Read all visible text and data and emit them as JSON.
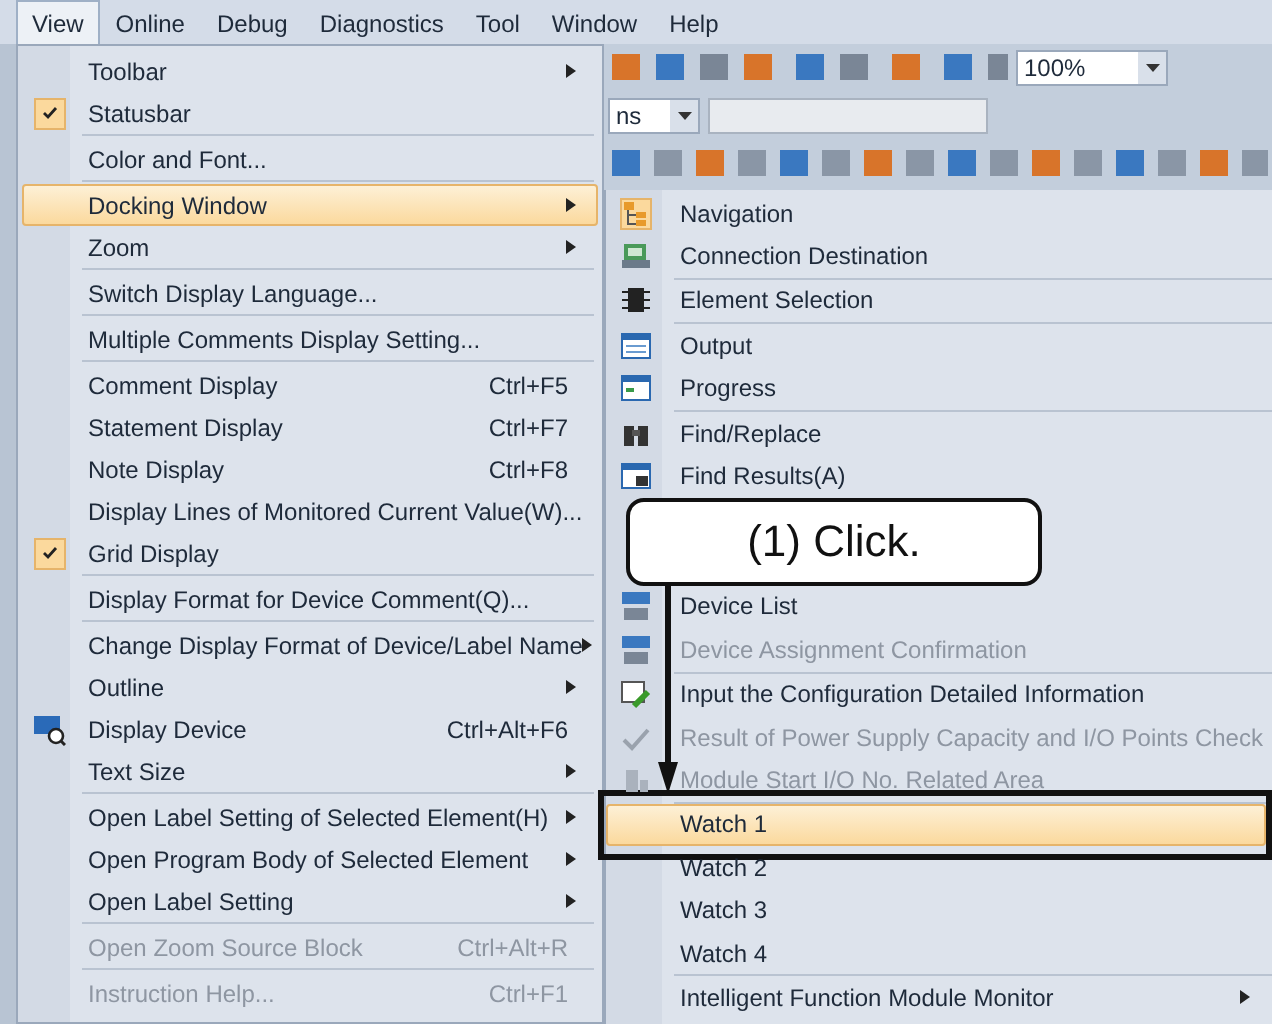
{
  "menubar": [
    {
      "label": "View",
      "selected": true
    },
    {
      "label": "Online",
      "selected": false
    },
    {
      "label": "Debug",
      "selected": false
    },
    {
      "label": "Diagnostics",
      "selected": false
    },
    {
      "label": "Tool",
      "selected": false
    },
    {
      "label": "Window",
      "selected": false
    },
    {
      "label": "Help",
      "selected": false
    }
  ],
  "toolbar": {
    "zoom_value": "100%",
    "combo_text": "ns"
  },
  "view_menu": [
    [
      {
        "label": "Toolbar",
        "checked": false,
        "selected": false,
        "disabled": false,
        "submenu": true
      },
      {
        "label": "Statusbar",
        "checked": true,
        "selected": false,
        "disabled": false,
        "submenu": false
      }
    ],
    [
      {
        "label": "Color and Font...",
        "checked": false,
        "selected": false,
        "disabled": false,
        "submenu": false
      }
    ],
    [
      {
        "label": "Docking Window",
        "checked": false,
        "selected": true,
        "disabled": false,
        "submenu": true
      },
      {
        "label": "Zoom",
        "checked": false,
        "selected": false,
        "disabled": false,
        "submenu": true
      }
    ],
    [
      {
        "label": "Switch Display Language...",
        "checked": false,
        "selected": false,
        "disabled": false,
        "submenu": false
      }
    ],
    [
      {
        "label": "Multiple Comments Display Setting...",
        "checked": false,
        "selected": false,
        "disabled": false,
        "submenu": false
      }
    ],
    [
      {
        "label": "Comment Display",
        "shortcut": "Ctrl+F5",
        "checked": false,
        "selected": false,
        "disabled": false,
        "submenu": false
      },
      {
        "label": "Statement Display",
        "shortcut": "Ctrl+F7",
        "checked": false,
        "selected": false,
        "disabled": false,
        "submenu": false
      },
      {
        "label": "Note Display",
        "shortcut": "Ctrl+F8",
        "checked": false,
        "selected": false,
        "disabled": false,
        "submenu": false
      },
      {
        "label": "Display Lines of Monitored Current Value(W)...",
        "checked": false,
        "selected": false,
        "disabled": false,
        "submenu": false
      },
      {
        "label": "Grid Display",
        "checked": true,
        "selected": false,
        "disabled": false,
        "submenu": false
      }
    ],
    [
      {
        "label": "Display Format for Device Comment(Q)...",
        "checked": false,
        "selected": false,
        "disabled": false,
        "submenu": false
      }
    ],
    [
      {
        "label": "Change Display Format of Device/Label Name",
        "checked": false,
        "selected": false,
        "disabled": false,
        "submenu": true
      },
      {
        "label": "Outline",
        "checked": false,
        "selected": false,
        "disabled": false,
        "submenu": true
      },
      {
        "label": "Display Device",
        "shortcut": "Ctrl+Alt+F6",
        "checked": false,
        "selected": false,
        "disabled": false,
        "submenu": false
      },
      {
        "label": "Text Size",
        "checked": false,
        "selected": false,
        "disabled": false,
        "submenu": true
      }
    ],
    [
      {
        "label": "Open Label Setting of Selected Element(H)",
        "checked": false,
        "selected": false,
        "disabled": false,
        "submenu": true
      },
      {
        "label": "Open Program Body of Selected Element",
        "checked": false,
        "selected": false,
        "disabled": false,
        "submenu": true
      },
      {
        "label": "Open Label Setting",
        "checked": false,
        "selected": false,
        "disabled": false,
        "submenu": true
      }
    ],
    [
      {
        "label": "Open Zoom Source Block",
        "shortcut": "Ctrl+Alt+R",
        "checked": false,
        "selected": false,
        "disabled": true,
        "submenu": false
      }
    ],
    [
      {
        "label": "Instruction Help...",
        "shortcut": "Ctrl+F1",
        "checked": false,
        "selected": false,
        "disabled": true,
        "submenu": false
      }
    ]
  ],
  "docking_submenu": [
    [
      {
        "label": "Navigation",
        "selected": false,
        "disabled": false,
        "submenu": false
      },
      {
        "label": "Connection Destination",
        "selected": false,
        "disabled": false,
        "submenu": false
      }
    ],
    [
      {
        "label": "Element Selection",
        "selected": false,
        "disabled": false,
        "submenu": false
      }
    ],
    [
      {
        "label": "Output",
        "selected": false,
        "disabled": false,
        "submenu": false
      },
      {
        "label": "Progress",
        "selected": false,
        "disabled": false,
        "submenu": false
      }
    ],
    [
      {
        "label": "Find/Replace",
        "selected": false,
        "disabled": false,
        "submenu": false
      },
      {
        "label": "Find Results(A)",
        "selected": false,
        "disabled": false,
        "submenu": false
      }
    ],
    [
      {
        "label": "Device List",
        "selected": false,
        "disabled": false,
        "submenu": false
      },
      {
        "label": "Device Assignment Confirmation",
        "selected": false,
        "disabled": true,
        "submenu": false
      }
    ],
    [
      {
        "label": "Input the Configuration Detailed Information",
        "selected": false,
        "disabled": false,
        "submenu": false
      },
      {
        "label": "Result of Power Supply Capacity and I/O Points Check",
        "selected": false,
        "disabled": true,
        "submenu": false
      },
      {
        "label": "Module Start I/O No. Related Area",
        "selected": false,
        "disabled": true,
        "submenu": false
      }
    ],
    [
      {
        "label": "Watch 1",
        "selected": true,
        "disabled": false,
        "submenu": false
      },
      {
        "label": "Watch 2",
        "selected": false,
        "disabled": false,
        "submenu": false
      },
      {
        "label": "Watch 3",
        "selected": false,
        "disabled": false,
        "submenu": false
      },
      {
        "label": "Watch 4",
        "selected": false,
        "disabled": false,
        "submenu": false
      }
    ],
    [
      {
        "label": "Intelligent Function Module Monitor",
        "selected": false,
        "disabled": false,
        "submenu": true
      }
    ]
  ],
  "callout": {
    "text": "(1) Click."
  }
}
